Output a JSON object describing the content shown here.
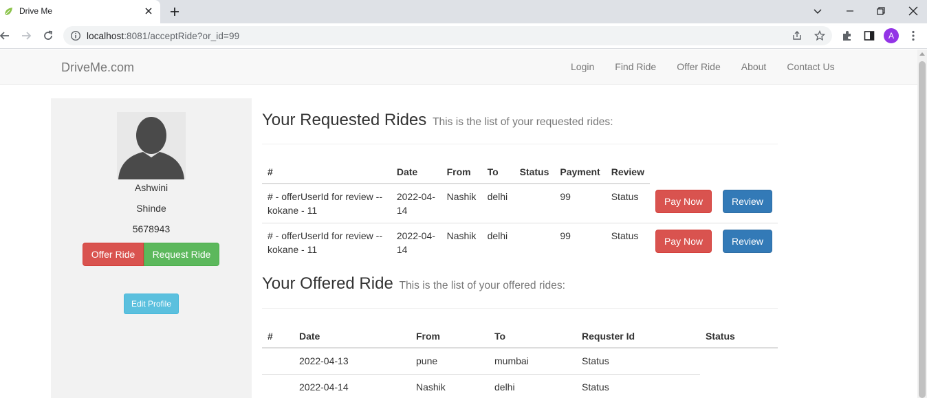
{
  "browser": {
    "tab_title": "Drive Me",
    "url_host": "localhost",
    "url_rest": ":8081/acceptRide?or_id=99",
    "profile_initial": "A"
  },
  "navbar": {
    "brand": "DriveMe.com",
    "links": [
      "Login",
      "Find Ride",
      "Offer Ride",
      "About",
      "Contact Us"
    ]
  },
  "profile": {
    "first_name": "Ashwini",
    "last_name": "Shinde",
    "phone": "5678943",
    "offer_ride_label": "Offer Ride",
    "request_ride_label": "Request Ride",
    "edit_profile_label": "Edit Profile"
  },
  "requested": {
    "title": "Your Requested Rides",
    "subtitle": "This is the list of your requested rides:",
    "headers": [
      "#",
      "Date",
      "From",
      "To",
      "Status",
      "Payment",
      "Review"
    ],
    "rows": [
      {
        "id": "# - offerUserId for review -- kokane - 11",
        "date": "2022-04-14",
        "from": "Nashik",
        "to": "delhi",
        "status": "",
        "payment": "99",
        "review": "Status",
        "pay_label": "Pay Now",
        "review_label": "Review"
      },
      {
        "id": "# - offerUserId for review -- kokane - 11",
        "date": "2022-04-14",
        "from": "Nashik",
        "to": "delhi",
        "status": "",
        "payment": "99",
        "review": "Status",
        "pay_label": "Pay Now",
        "review_label": "Review"
      }
    ]
  },
  "offered": {
    "title": "Your Offered Ride",
    "subtitle": "This is the list of your offered rides:",
    "headers": [
      "#",
      "Date",
      "From",
      "To",
      "Requster Id",
      "Status"
    ],
    "rows": [
      {
        "id": "",
        "date": "2022-04-13",
        "from": "pune",
        "to": "mumbai",
        "requester": "Status"
      },
      {
        "id": "",
        "date": "2022-04-14",
        "from": "Nashik",
        "to": "delhi",
        "requester": "Status"
      }
    ]
  },
  "colors": {
    "danger": "#d9534f",
    "success": "#5cb85c",
    "primary": "#337ab7",
    "info": "#5bc0de"
  }
}
